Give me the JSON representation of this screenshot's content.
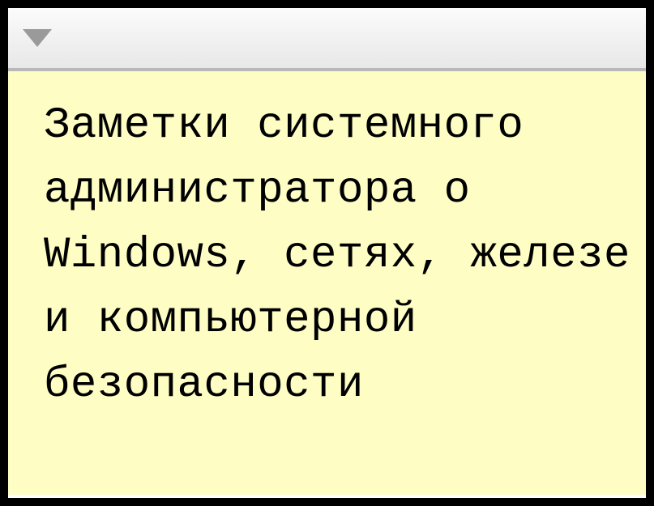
{
  "note": {
    "body_text": "Заметки системного администратора о Windows, сетях, железе и компьютерной безопасности"
  },
  "colors": {
    "note_background": "#fdfdc4",
    "titlebar_gradient_top": "#fcfcfc",
    "titlebar_gradient_bottom": "#e8e8e8",
    "dropdown_arrow": "#9a9a9a",
    "border": "#000000"
  }
}
